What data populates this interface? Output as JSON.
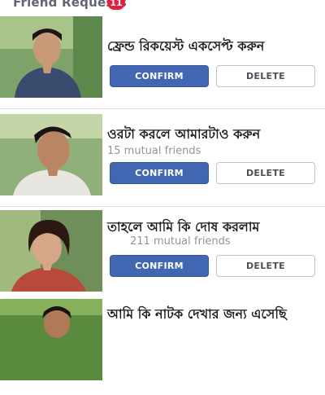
{
  "header": {
    "title": "Friend Requests",
    "badge_count": "11"
  },
  "requests": [
    {
      "name": "ফ্রেন্ড রিকয়েস্ট একসেপ্ট করুন",
      "mutual": "",
      "confirm_label": "CONFIRM",
      "delete_label": "DELETE"
    },
    {
      "name": "ওরটা করলে আমারটাও করুন",
      "mutual": "15 mutual friends",
      "confirm_label": "CONFIRM",
      "delete_label": "DELETE"
    },
    {
      "name": "তাহলে আমি কি দোষ করলাম",
      "mutual": "211 mutual friends",
      "confirm_label": "CONFIRM",
      "delete_label": "DELETE"
    },
    {
      "name": "আমি কি নাটক দেখার জন্য এসেছি",
      "mutual": "",
      "confirm_label": "",
      "delete_label": ""
    }
  ],
  "colors": {
    "confirm_bg": "#4267b2",
    "badge_bg": "#e41e3f",
    "divider": "#dddfe2"
  }
}
